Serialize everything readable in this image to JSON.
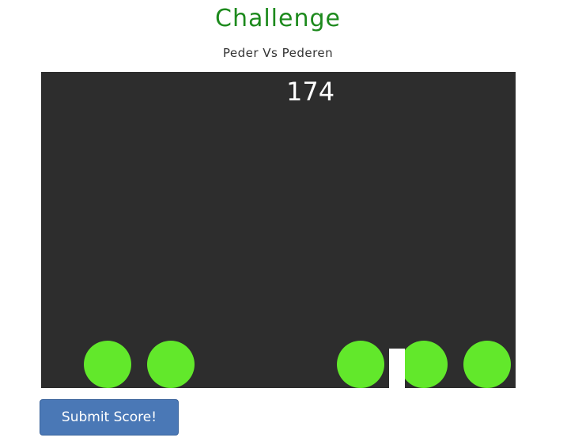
{
  "header": {
    "title": "Challenge",
    "subtitle": "Peder Vs Pederen"
  },
  "game": {
    "score": "174",
    "background_color": "#2d2d2d",
    "ball_color": "#62e82b",
    "player_color": "#ffffff",
    "ball_count": 5
  },
  "actions": {
    "submit_label": "Submit Score!"
  }
}
